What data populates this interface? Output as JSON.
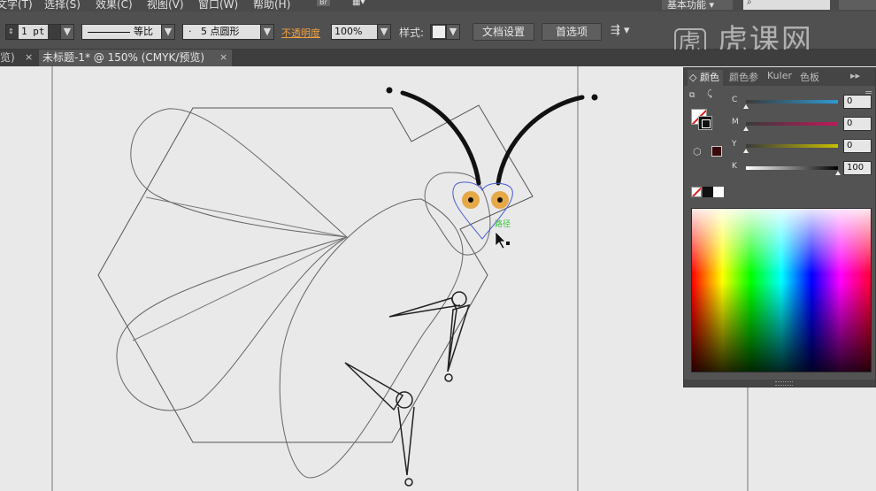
{
  "menubar": {
    "items": [
      "文字(T)",
      "选择(S)",
      "效果(C)",
      "视图(V)",
      "窗口(W)",
      "帮助(H)"
    ],
    "br_label": "Br",
    "workspace": "基本功能"
  },
  "control_bar": {
    "stroke_weight": "1 pt",
    "stroke_profile": "等比",
    "brush": "5 点圆形",
    "opacity_label": "不透明度",
    "opacity_value": "100%",
    "style_label": "样式:",
    "doc_setup_button": "文档设置",
    "preferences_button": "首选项"
  },
  "tabs": {
    "prev_tab_label": "览)",
    "active_tab_label": "未标题-1* @ 150% (CMYK/预览)",
    "close_glyph": "×"
  },
  "watermark": "虎课网",
  "color_panel": {
    "tabs": [
      "颜色",
      "颜色参",
      "Kuler",
      "色板"
    ],
    "channels": [
      {
        "label": "C",
        "value": "0",
        "track": [
          "#3a3a3a",
          "#2e9bd6"
        ],
        "level": 0
      },
      {
        "label": "M",
        "value": "0",
        "track": [
          "#3a3a3a",
          "#c0185a"
        ],
        "level": 0
      },
      {
        "label": "Y",
        "value": "0",
        "track": [
          "#3a3a3a",
          "#c8c000"
        ],
        "level": 0
      },
      {
        "label": "K",
        "value": "100",
        "track": [
          "#ffffff",
          "#000000"
        ],
        "level": 1
      }
    ],
    "fill_color": "#3a0a0a"
  },
  "artwork": {
    "path_label": "路径",
    "eye_color": "#e6a948",
    "selection_color": "#4a5ad0",
    "label_color": "#39c639"
  }
}
